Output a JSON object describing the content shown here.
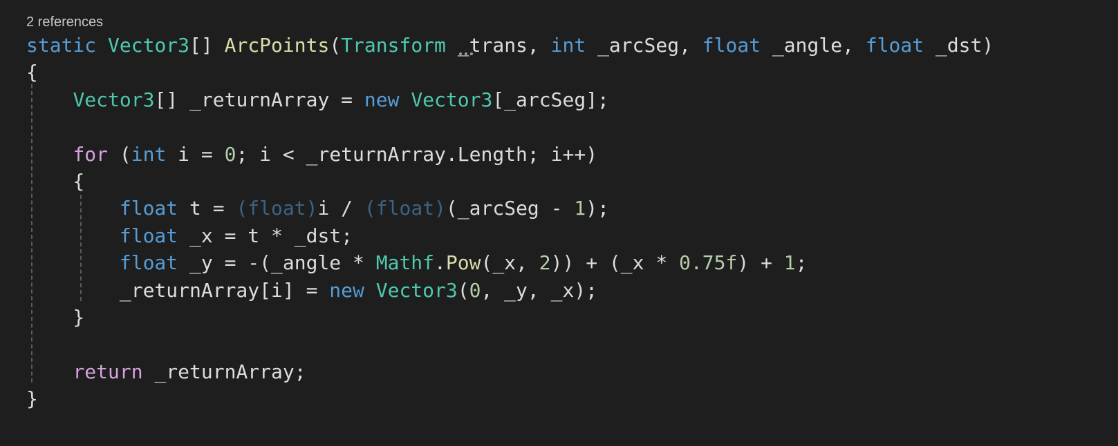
{
  "editor": {
    "codelens": "2 references",
    "lines": [
      [
        {
          "t": "static",
          "c": "kw"
        },
        {
          "t": " ",
          "c": "pl"
        },
        {
          "t": "Vector3",
          "c": "ty"
        },
        {
          "t": "[] ",
          "c": "pl"
        },
        {
          "t": "ArcPoints",
          "c": "fn"
        },
        {
          "t": "(",
          "c": "pl"
        },
        {
          "t": "Transform",
          "c": "ty"
        },
        {
          "t": " ",
          "c": "pl"
        },
        {
          "t": "_trans",
          "c": "pl unused"
        },
        {
          "t": ", ",
          "c": "pl"
        },
        {
          "t": "int",
          "c": "kw"
        },
        {
          "t": " _arcSeg, ",
          "c": "pl"
        },
        {
          "t": "float",
          "c": "kw"
        },
        {
          "t": " _angle, ",
          "c": "pl"
        },
        {
          "t": "float",
          "c": "kw"
        },
        {
          "t": " _dst)",
          "c": "pl"
        }
      ],
      [
        {
          "t": "{",
          "c": "pl"
        }
      ],
      [
        {
          "t": "    ",
          "c": "pl"
        },
        {
          "t": "Vector3",
          "c": "ty"
        },
        {
          "t": "[] _returnArray = ",
          "c": "pl"
        },
        {
          "t": "new",
          "c": "kw"
        },
        {
          "t": " ",
          "c": "pl"
        },
        {
          "t": "Vector3",
          "c": "ty"
        },
        {
          "t": "[_arcSeg];",
          "c": "pl"
        }
      ],
      [],
      [
        {
          "t": "    ",
          "c": "pl"
        },
        {
          "t": "for",
          "c": "ctl"
        },
        {
          "t": " (",
          "c": "pl"
        },
        {
          "t": "int",
          "c": "kw"
        },
        {
          "t": " i = ",
          "c": "pl"
        },
        {
          "t": "0",
          "c": "num"
        },
        {
          "t": "; i < _returnArray.Length; i++)",
          "c": "pl"
        }
      ],
      [
        {
          "t": "    {",
          "c": "pl"
        }
      ],
      [
        {
          "t": "        ",
          "c": "pl"
        },
        {
          "t": "float",
          "c": "kw"
        },
        {
          "t": " t = ",
          "c": "pl"
        },
        {
          "t": "(float)",
          "c": "kw dim"
        },
        {
          "t": "i / ",
          "c": "pl"
        },
        {
          "t": "(float)",
          "c": "kw dim"
        },
        {
          "t": "(_arcSeg - ",
          "c": "pl"
        },
        {
          "t": "1",
          "c": "num"
        },
        {
          "t": ");",
          "c": "pl"
        }
      ],
      [
        {
          "t": "        ",
          "c": "pl"
        },
        {
          "t": "float",
          "c": "kw"
        },
        {
          "t": " _x = t * _dst;",
          "c": "pl"
        }
      ],
      [
        {
          "t": "        ",
          "c": "pl"
        },
        {
          "t": "float",
          "c": "kw"
        },
        {
          "t": " _y = -(_angle * ",
          "c": "pl"
        },
        {
          "t": "Mathf",
          "c": "ty"
        },
        {
          "t": ".",
          "c": "pl"
        },
        {
          "t": "Pow",
          "c": "fn"
        },
        {
          "t": "(_x, ",
          "c": "pl"
        },
        {
          "t": "2",
          "c": "num"
        },
        {
          "t": ")) + (_x * ",
          "c": "pl"
        },
        {
          "t": "0.75f",
          "c": "num"
        },
        {
          "t": ") + ",
          "c": "pl"
        },
        {
          "t": "1",
          "c": "num"
        },
        {
          "t": ";",
          "c": "pl"
        }
      ],
      [
        {
          "t": "        _returnArray[i] = ",
          "c": "pl"
        },
        {
          "t": "new",
          "c": "kw"
        },
        {
          "t": " ",
          "c": "pl"
        },
        {
          "t": "Vector3",
          "c": "ty"
        },
        {
          "t": "(",
          "c": "pl"
        },
        {
          "t": "0",
          "c": "num"
        },
        {
          "t": ", _y, _x);",
          "c": "pl"
        }
      ],
      [
        {
          "t": "    }",
          "c": "pl"
        }
      ],
      [],
      [
        {
          "t": "    ",
          "c": "pl"
        },
        {
          "t": "return",
          "c": "ctl"
        },
        {
          "t": " _returnArray;",
          "c": "pl"
        }
      ],
      [
        {
          "t": "}",
          "c": "pl"
        }
      ]
    ]
  }
}
